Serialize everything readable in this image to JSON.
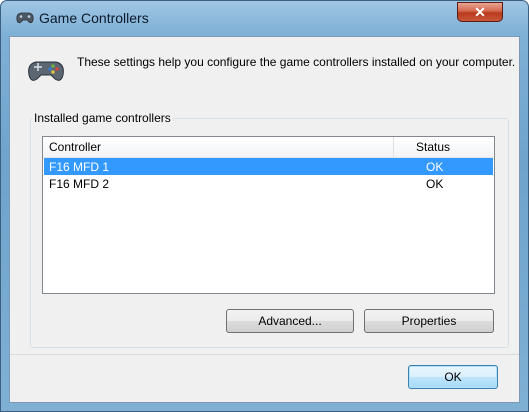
{
  "window": {
    "title": "Game Controllers",
    "close_label": "✕"
  },
  "header": {
    "text": "These settings help you configure the game controllers installed on your computer."
  },
  "group": {
    "label": "Installed game controllers"
  },
  "list": {
    "columns": [
      "Controller",
      "Status"
    ],
    "rows": [
      {
        "name": "F16 MFD 1",
        "status": "OK",
        "selected": true
      },
      {
        "name": "F16 MFD 2",
        "status": "OK",
        "selected": false
      }
    ]
  },
  "buttons": {
    "advanced": "Advanced...",
    "properties": "Properties",
    "ok": "OK"
  },
  "icons": {
    "title": "gamepad-icon",
    "header": "gamepad-icon"
  },
  "colors": {
    "selection": "#3399ff",
    "close": "#c9573b"
  }
}
